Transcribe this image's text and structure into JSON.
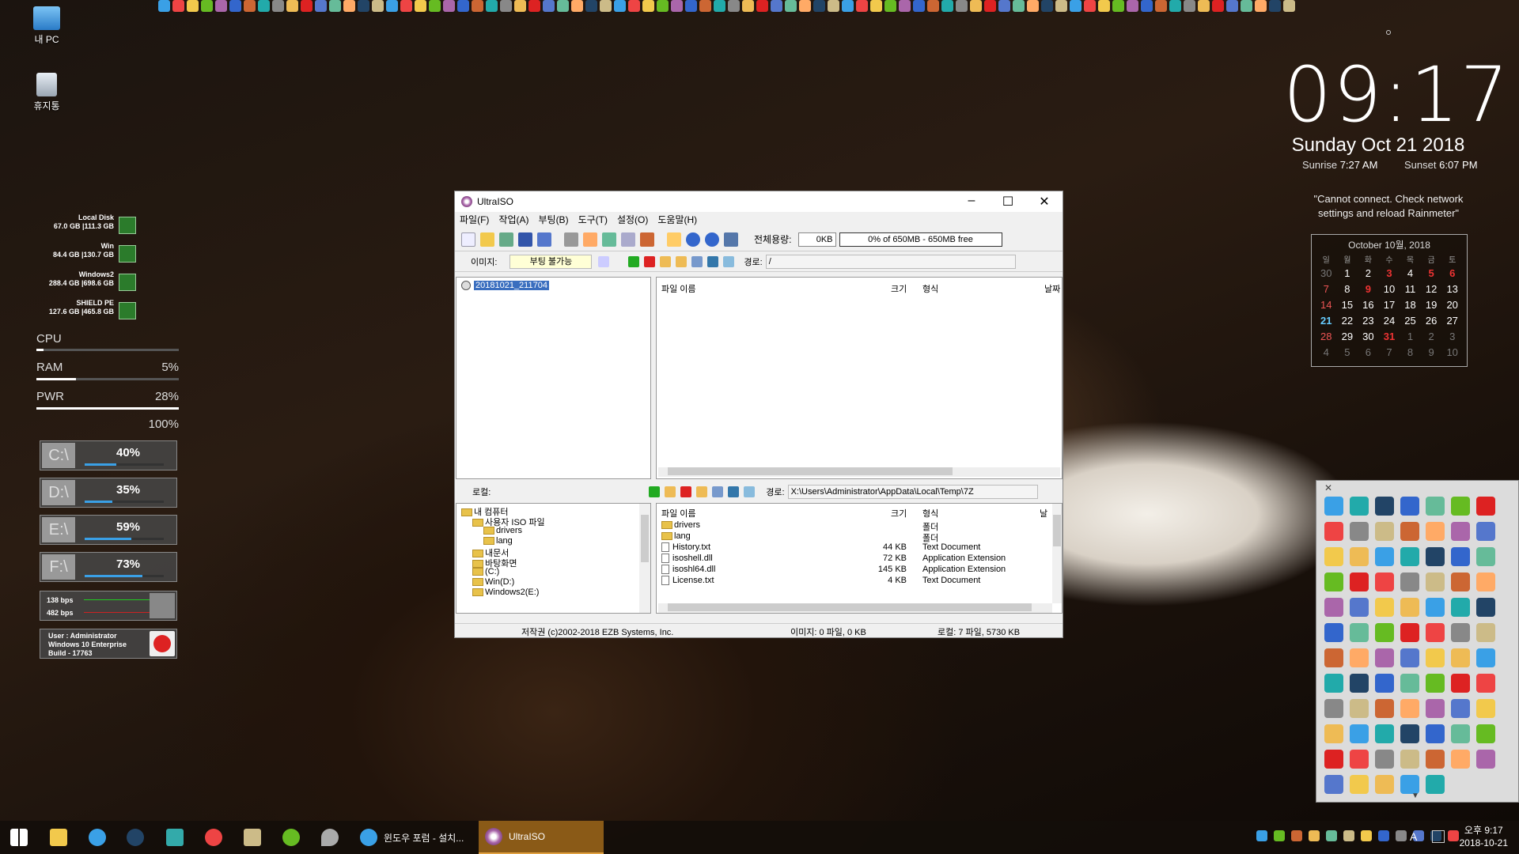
{
  "desktop": {
    "icons": [
      {
        "label": "내 PC",
        "icon": "computer-icon"
      },
      {
        "label": "휴지통",
        "icon": "recycle-bin-icon"
      }
    ]
  },
  "drives_meter": [
    {
      "name": "Local Disk",
      "sizes": "67.0 GB  |111.3 GB"
    },
    {
      "name": "Win",
      "sizes": "84.4 GB  |130.7 GB"
    },
    {
      "name": "Windows2",
      "sizes": "288.4 GB  |698.6 GB"
    },
    {
      "name": "SHIELD PE",
      "sizes": "127.6 GB  |465.8 GB"
    }
  ],
  "system_meter": {
    "cpu_label": "CPU",
    "ram_label": "RAM",
    "ram_value": "5%",
    "pwr_label": "PWR",
    "pwr_value": "28%",
    "extra_value": "100%"
  },
  "disk_panels": [
    {
      "letter": "C:\\",
      "percent": "40%",
      "fill": 0.4
    },
    {
      "letter": "D:\\",
      "percent": "35%",
      "fill": 0.35
    },
    {
      "letter": "E:\\",
      "percent": "59%",
      "fill": 0.59
    },
    {
      "letter": "F:\\",
      "percent": "73%",
      "fill": 0.73
    }
  ],
  "network": {
    "up": "138 bps",
    "down": "482 bps"
  },
  "user_panel": {
    "line1": "User : Administrator",
    "line2": "Windows 10 Enterprise",
    "line3": "Build - 17763"
  },
  "clock": {
    "time": "09:17",
    "date": "Sunday Oct 21 2018",
    "sunrise_label": "Sunrise",
    "sunrise": "7:27 AM",
    "sunset_label": "Sunset",
    "sunset": "6:07 PM",
    "weather_msg": "\"Cannot connect. Check network settings and reload Rainmeter\""
  },
  "calendar": {
    "header": "October 10월, 2018",
    "weekdays": [
      "일",
      "월",
      "화",
      "수",
      "목",
      "금",
      "토"
    ],
    "weeks": [
      [
        "30",
        "1",
        "2",
        "3",
        "4",
        "5",
        "6"
      ],
      [
        "7",
        "8",
        "9",
        "10",
        "11",
        "12",
        "13"
      ],
      [
        "14",
        "15",
        "16",
        "17",
        "18",
        "19",
        "20"
      ],
      [
        "21",
        "22",
        "23",
        "24",
        "25",
        "26",
        "27"
      ],
      [
        "28",
        "29",
        "30",
        "31",
        "1",
        "2",
        "3"
      ],
      [
        "4",
        "5",
        "6",
        "7",
        "8",
        "9",
        "10"
      ]
    ]
  },
  "window": {
    "title": "UltraISO",
    "menu": [
      "파일(F)",
      "작업(A)",
      "부팅(B)",
      "도구(T)",
      "설정(O)",
      "도움말(H)"
    ],
    "capacity_label": "전체용량:",
    "capacity_value": "0KB",
    "capacity_bar": "0% of 650MB - 650MB free",
    "image_label": "이미지:",
    "boot_state": "부팅 불가능",
    "path_label": "경로:",
    "iso_path": "/",
    "iso_tree_item": "20181021_211704",
    "iso_cols": [
      "파일 이름",
      "크기",
      "형식",
      "날짜"
    ],
    "local_label": "로컬:",
    "local_path": "X:\\Users\\Administrator\\AppData\\Local\\Temp\\7Z",
    "local_tree": [
      {
        "label": "내 컴퓨터",
        "indent": 0
      },
      {
        "label": "사용자 ISO 파일",
        "indent": 1
      },
      {
        "label": "drivers",
        "indent": 2
      },
      {
        "label": "lang",
        "indent": 2
      },
      {
        "label": "내문서",
        "indent": 1
      },
      {
        "label": "바탕화면",
        "indent": 1
      },
      {
        "label": "(C:)",
        "indent": 1
      },
      {
        "label": "Win(D:)",
        "indent": 1
      },
      {
        "label": "Windows2(E:)",
        "indent": 1
      }
    ],
    "local_cols": [
      "파일 이름",
      "크기",
      "형식",
      "날"
    ],
    "local_files": [
      {
        "name": "drivers",
        "size": "",
        "type": "폴더",
        "folder": true
      },
      {
        "name": "lang",
        "size": "",
        "type": "폴더",
        "folder": true
      },
      {
        "name": "History.txt",
        "size": "44 KB",
        "type": "Text Document",
        "folder": false
      },
      {
        "name": "isoshell.dll",
        "size": "72 KB",
        "type": "Application Extension",
        "folder": false
      },
      {
        "name": "isoshl64.dll",
        "size": "145 KB",
        "type": "Application Extension",
        "folder": false
      },
      {
        "name": "License.txt",
        "size": "4 KB",
        "type": "Text Document",
        "folder": false
      }
    ],
    "status_copyright": "저작권 (c)2002-2018 EZB Systems, Inc.",
    "status_image": "이미지: 0 파일, 0 KB",
    "status_local": "로컬: 7 파일, 5730 KB"
  },
  "taskbar": {
    "tasks": [
      {
        "label": "윈도우 포럼 - 설치..."
      },
      {
        "label": "UltraISO"
      }
    ],
    "time": "오후 9:17",
    "date": "2018-10-21",
    "ime": "A"
  },
  "colors": {
    "accent_blue": "#3aa0e6",
    "calendar_red": "#e33",
    "today_blue": "#6cf",
    "drive_green": "#2b7b2b"
  }
}
